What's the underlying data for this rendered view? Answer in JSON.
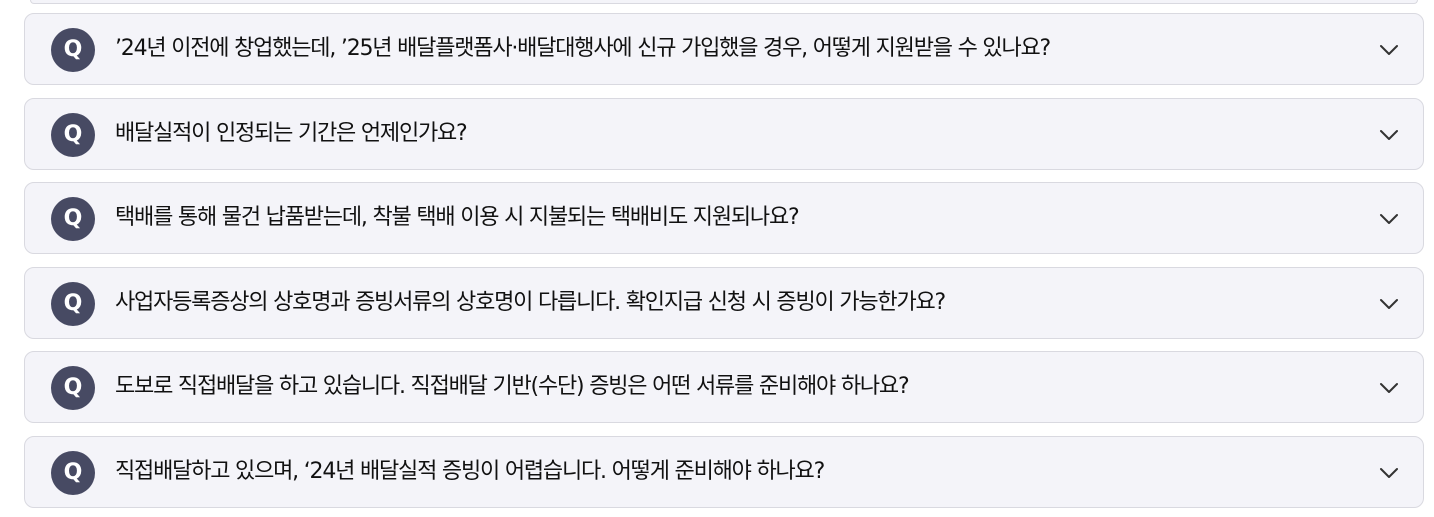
{
  "faq": {
    "badge": "Q",
    "items": [
      {
        "question": "’24년 이전에 창업했는데, ’25년 배달플랫폼사·배달대행사에 신규 가입했을 경우, 어떻게 지원받을 수 있나요?"
      },
      {
        "question": "배달실적이 인정되는 기간은 언제인가요?"
      },
      {
        "question": "택배를 통해 물건 납품받는데, 착불 택배 이용 시 지불되는 택배비도 지원되나요?"
      },
      {
        "question": "사업자등록증상의 상호명과 증빙서류의 상호명이 다릅니다. 확인지급 신청 시 증빙이 가능한가요?"
      },
      {
        "question": "도보로 직접배달을 하고 있습니다. 직접배달 기반(수단) 증빙은 어떤 서류를 준비해야 하나요?"
      },
      {
        "question": "직접배달하고 있으며, ‘24년 배달실적 증빙이 어렵습니다. 어떻게 준비해야 하나요?"
      }
    ]
  },
  "colors": {
    "badge_bg": "#474a63",
    "item_bg": "#f4f4f9",
    "item_border": "#d9d9e0",
    "text": "#111111"
  },
  "icons": {
    "expand": "chevron-down-icon"
  }
}
